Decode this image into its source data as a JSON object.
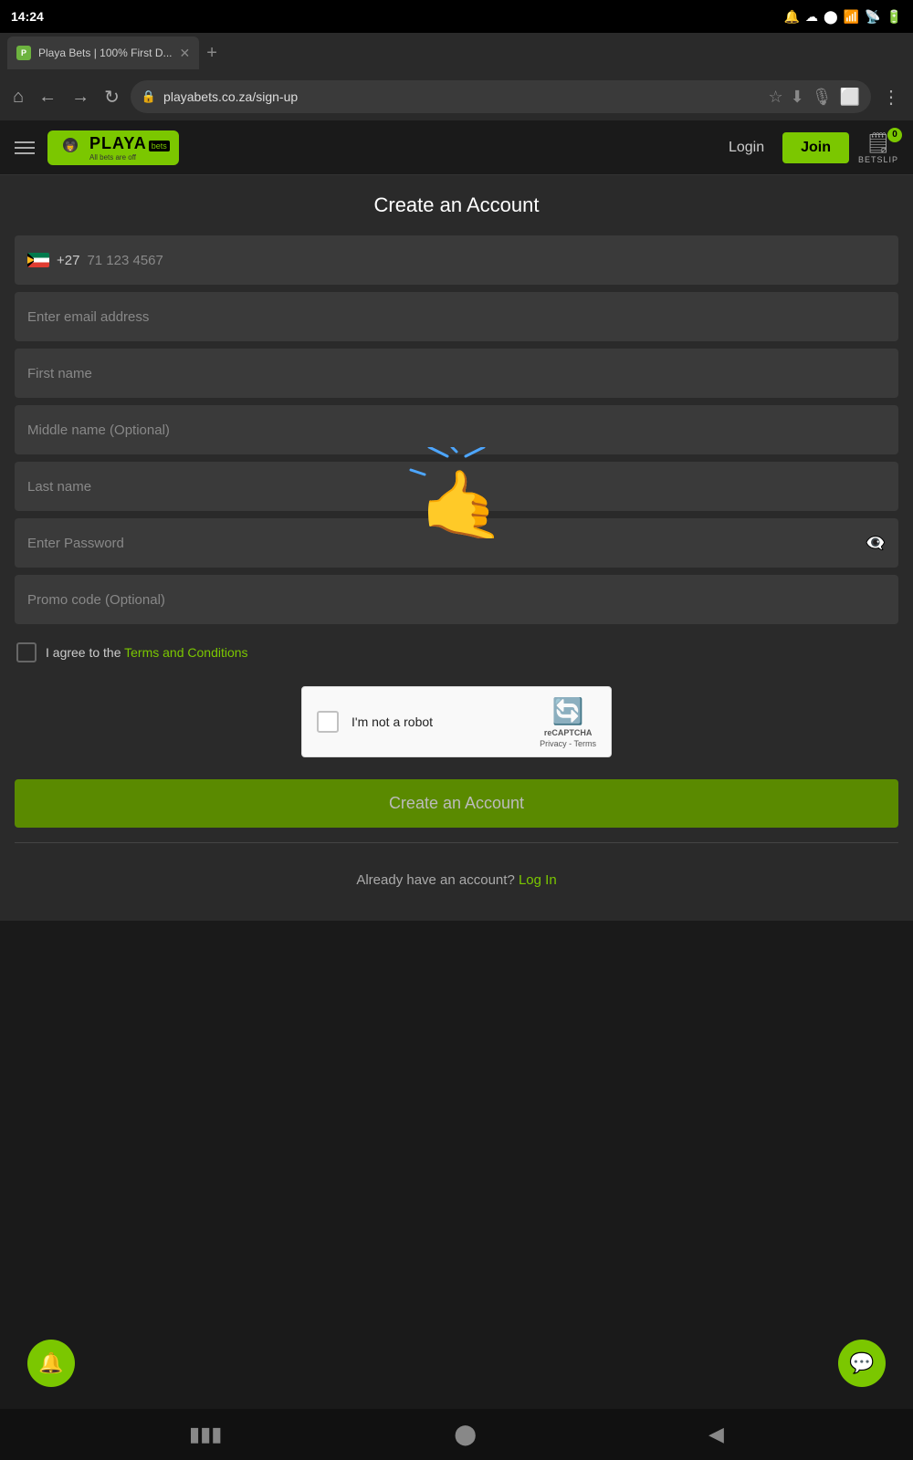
{
  "statusBar": {
    "time": "14:24",
    "icons": [
      "notification",
      "cloud",
      "circle"
    ]
  },
  "browser": {
    "tab": {
      "title": "Playa Bets | 100% First D...",
      "favicon": "P"
    },
    "url": "playabets.co.za/sign-up"
  },
  "header": {
    "logo": {
      "name": "PLAYA",
      "tagline": "All bets are off"
    },
    "loginLabel": "Login",
    "joinLabel": "Join",
    "betslipLabel": "BETSLIP",
    "betslipCount": "0"
  },
  "form": {
    "title": "Create an Account",
    "phonePlaceholder": "71 123 4567",
    "phoneCode": "+27",
    "emailPlaceholder": "Enter email address",
    "firstNamePlaceholder": "First name",
    "middleNamePlaceholder": "Middle name (Optional)",
    "lastNamePlaceholder": "Last name",
    "passwordPlaceholder": "Enter Password",
    "promoPlaceholder": "Promo code (Optional)",
    "termsPrefix": "I agree to the ",
    "termsLink": "Terms and Conditions",
    "recaptchaLabel": "I'm not a robot",
    "recaptchaBrand": "reCAPTCHA",
    "recaptchaLinks": "Privacy - Terms",
    "createButtonLabel": "Create an Account",
    "alreadyAccountText": "Already have an account? ",
    "logInLink": "Log In"
  }
}
